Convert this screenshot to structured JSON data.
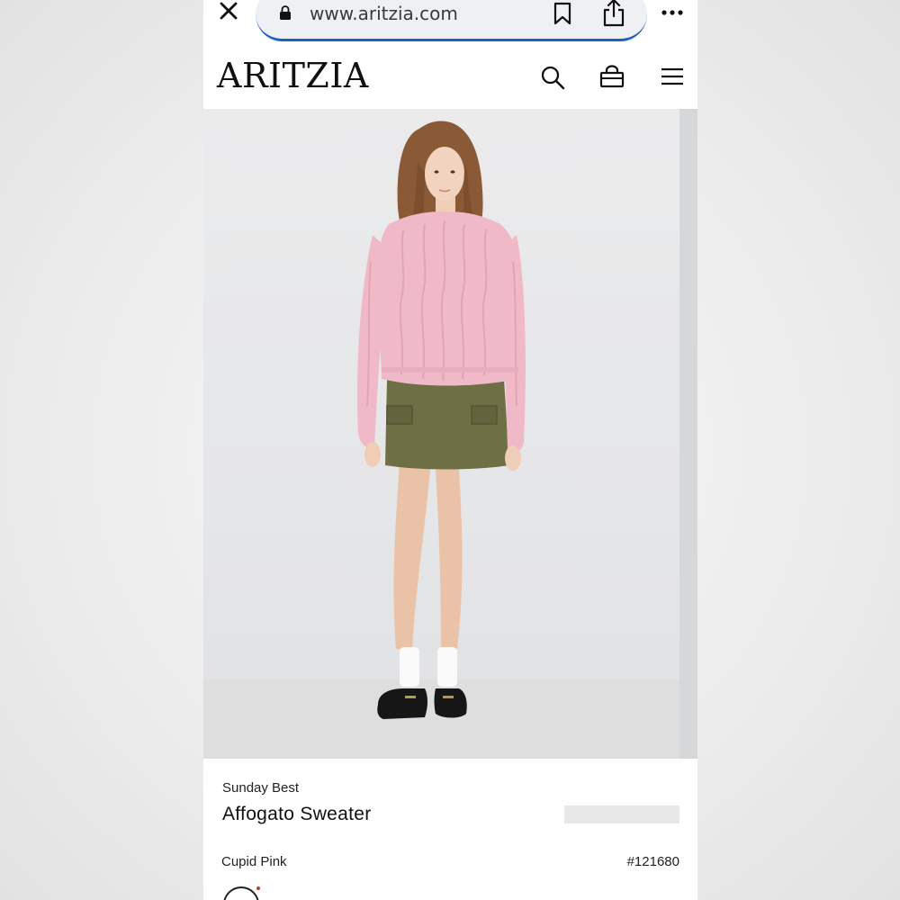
{
  "browser": {
    "url": "www.aritzia.com",
    "icons": [
      "close-icon",
      "lock-icon",
      "bookmark-icon",
      "share-icon",
      "more-icon"
    ],
    "accent": "#1f5fbf"
  },
  "header": {
    "logo": "ARITZIA",
    "icons": [
      "search-icon",
      "bag-icon",
      "menu-icon"
    ]
  },
  "product": {
    "brand": "Sunday Best",
    "name": "Affogato Sweater",
    "color": "Cupid Pink",
    "sku": "#121680",
    "sweater_color": "#f0b9c8",
    "skirt_color": "#6e6f45"
  }
}
